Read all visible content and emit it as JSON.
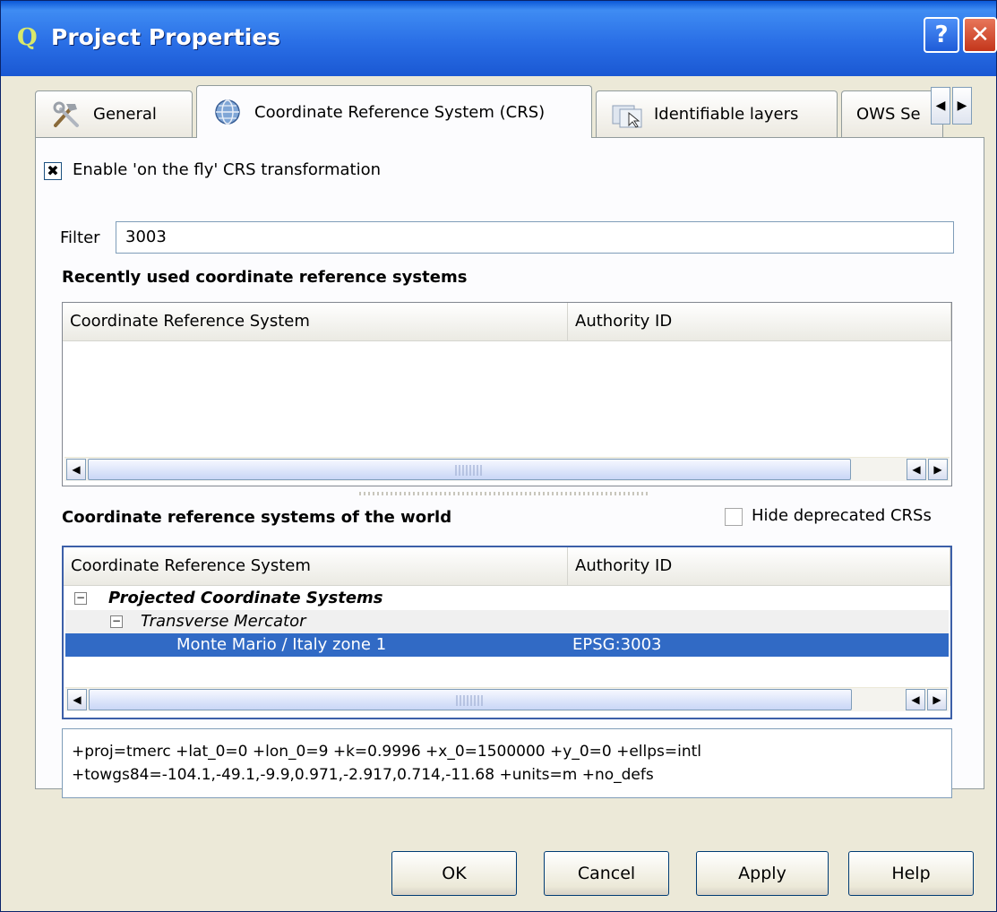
{
  "window": {
    "title": "Project Properties",
    "help_glyph": "?",
    "close_glyph": "✕"
  },
  "tabs": [
    {
      "label": "General",
      "icon": "hammer-wrench-icon"
    },
    {
      "label": "Coordinate Reference System (CRS)",
      "icon": "globe-icon",
      "active": true
    },
    {
      "label": "Identifiable layers",
      "icon": "identify-layers-icon"
    },
    {
      "label": "OWS Se"
    }
  ],
  "crs": {
    "enable_otf_label": "Enable 'on the fly' CRS transformation",
    "enable_otf_checked": true,
    "filter_label": "Filter",
    "filter_value": "3003",
    "recent_heading": "Recently used coordinate reference systems",
    "world_heading": "Coordinate reference systems of the world",
    "hide_deprecated_label": "Hide deprecated CRSs",
    "hide_deprecated_checked": false,
    "columns": [
      "Coordinate Reference System",
      "Authority ID"
    ],
    "tree": [
      {
        "label": "Projected Coordinate Systems",
        "authority": "",
        "level": 0,
        "expanded": true
      },
      {
        "label": "Transverse Mercator",
        "authority": "",
        "level": 1,
        "expanded": true
      },
      {
        "label": "Monte Mario / Italy zone 1",
        "authority": "EPSG:3003",
        "level": 2,
        "selected": true
      }
    ],
    "proj4_line1": "+proj=tmerc +lat_0=0 +lon_0=9 +k=0.9996 +x_0=1500000 +y_0=0 +ellps=intl",
    "proj4_line2": "+towgs84=-104.1,-49.1,-9.9,0.971,-2.917,0.714,-11.68 +units=m +no_defs"
  },
  "buttons": {
    "ok": "OK",
    "cancel": "Cancel",
    "apply": "Apply",
    "help": "Help"
  },
  "glyphs": {
    "check": "✖",
    "arrow_left": "◀",
    "arrow_right": "▶",
    "minus": "−"
  },
  "colors": {
    "title_bar": "#2a6fe6",
    "selection": "#316ac5",
    "dialog_bg": "#ece9d8"
  }
}
